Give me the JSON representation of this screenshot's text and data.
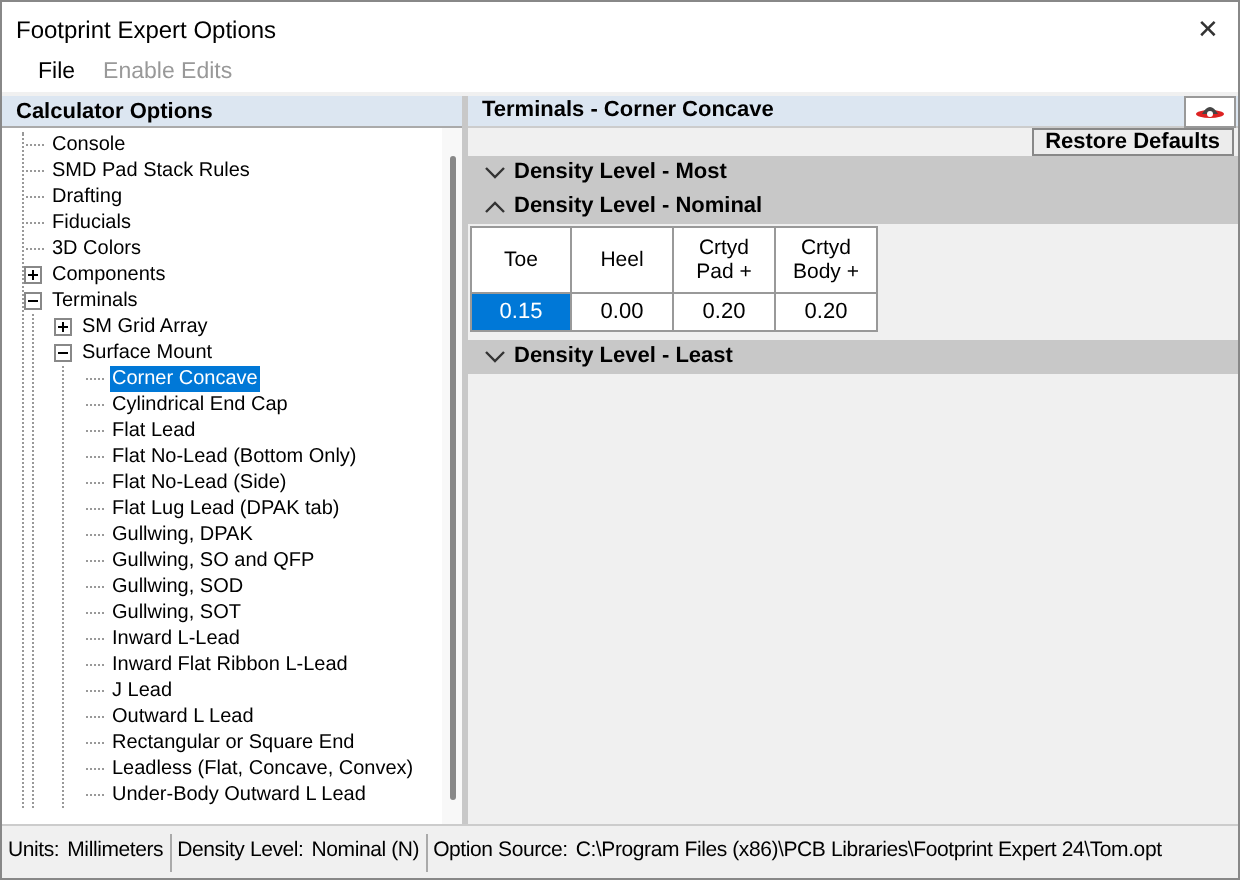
{
  "window": {
    "title": "Footprint Expert Options",
    "close": "✕"
  },
  "menu": [
    {
      "label": "File",
      "disabled": false
    },
    {
      "label": "Enable Edits",
      "disabled": true
    }
  ],
  "sidebar": {
    "title": "Calculator Options",
    "tree": [
      {
        "label": "Console",
        "selected": false
      },
      {
        "label": "SMD Pad Stack Rules",
        "selected": false
      },
      {
        "label": "Drafting",
        "selected": false
      },
      {
        "label": "Fiducials",
        "selected": false
      },
      {
        "label": "3D Colors",
        "selected": false
      },
      {
        "label": "Components",
        "selected": false,
        "expanded": false
      },
      {
        "label": "Terminals",
        "selected": false,
        "expanded": true,
        "children": [
          {
            "label": "SM Grid Array",
            "selected": false,
            "expanded": false
          },
          {
            "label": "Surface Mount",
            "selected": false,
            "expanded": true,
            "children": [
              {
                "label": "Corner Concave",
                "selected": true
              },
              {
                "label": "Cylindrical End Cap",
                "selected": false
              },
              {
                "label": "Flat Lead",
                "selected": false
              },
              {
                "label": "Flat No-Lead (Bottom Only)",
                "selected": false
              },
              {
                "label": "Flat No-Lead (Side)",
                "selected": false
              },
              {
                "label": "Flat Lug Lead (DPAK tab)",
                "selected": false
              },
              {
                "label": "Gullwing, DPAK",
                "selected": false
              },
              {
                "label": "Gullwing, SO and QFP",
                "selected": false
              },
              {
                "label": "Gullwing, SOD",
                "selected": false
              },
              {
                "label": "Gullwing, SOT",
                "selected": false
              },
              {
                "label": "Inward L-Lead",
                "selected": false
              },
              {
                "label": "Inward Flat Ribbon L-Lead",
                "selected": false
              },
              {
                "label": "J Lead",
                "selected": false
              },
              {
                "label": "Outward L Lead",
                "selected": false
              },
              {
                "label": "Rectangular or Square End",
                "selected": false
              },
              {
                "label": "Leadless (Flat, Concave, Convex)",
                "selected": false
              },
              {
                "label": "Under-Body Outward L Lead",
                "selected": false
              }
            ]
          }
        ]
      }
    ]
  },
  "panel": {
    "title": "Terminals - Corner Concave",
    "restore_button": "Restore Defaults",
    "sections": [
      {
        "title": "Density Level - Most",
        "expanded": false
      },
      {
        "title": "Density Level - Nominal",
        "expanded": true,
        "table": {
          "columns": [
            "Toe",
            "Heel",
            "Crtyd\nPad +",
            "Crtyd\nBody +"
          ],
          "rows": [
            [
              {
                "text": "0.15",
                "selected": true
              },
              {
                "text": "0.00",
                "selected": false
              },
              {
                "text": "0.20",
                "selected": false
              },
              {
                "text": "0.20",
                "selected": false
              }
            ]
          ]
        }
      },
      {
        "title": "Density Level - Least",
        "expanded": false
      }
    ]
  },
  "status_bar": [
    {
      "label": "Units:",
      "value": "Millimeters"
    },
    {
      "label": "Density Level:",
      "value": "Nominal (N)"
    },
    {
      "label": "Option Source:",
      "value": "C:\\Program Files (x86)\\PCB Libraries\\Footprint Expert 24\\Tom.opt"
    }
  ]
}
